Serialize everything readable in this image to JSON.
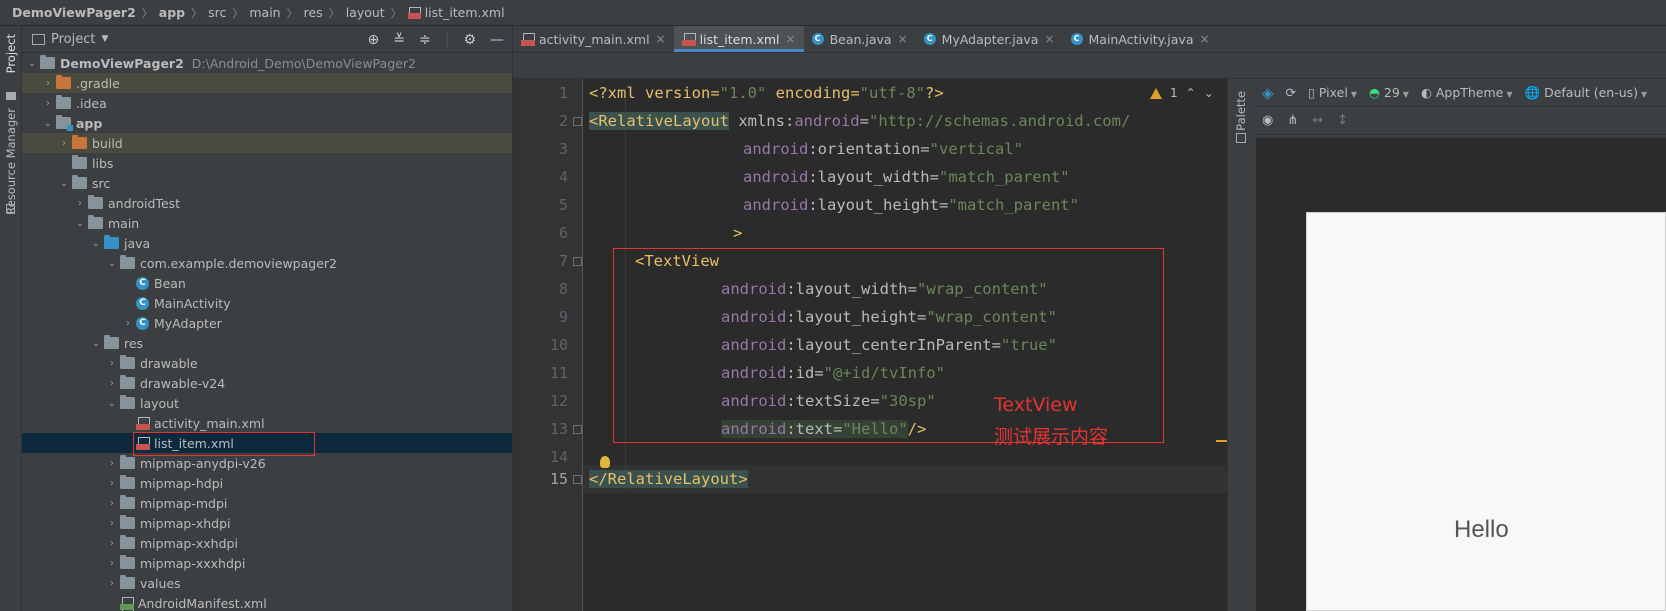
{
  "breadcrumb": [
    "DemoViewPager2",
    "app",
    "src",
    "main",
    "res",
    "layout",
    "list_item.xml"
  ],
  "left_stripe": {
    "project": "Project",
    "resource_manager": "Resource Manager"
  },
  "project_panel": {
    "title": "Project",
    "tree": [
      {
        "label": "DemoViewPager2",
        "extra": "D:\\Android_Demo\\DemoViewPager2"
      },
      {
        "label": ".gradle"
      },
      {
        "label": ".idea"
      },
      {
        "label": "app"
      },
      {
        "label": "build"
      },
      {
        "label": "libs"
      },
      {
        "label": "src"
      },
      {
        "label": "androidTest"
      },
      {
        "label": "main"
      },
      {
        "label": "java"
      },
      {
        "label": "com.example.demoviewpager2"
      },
      {
        "label": "Bean"
      },
      {
        "label": "MainActivity"
      },
      {
        "label": "MyAdapter"
      },
      {
        "label": "res"
      },
      {
        "label": "drawable"
      },
      {
        "label": "drawable-v24"
      },
      {
        "label": "layout"
      },
      {
        "label": "activity_main.xml"
      },
      {
        "label": "list_item.xml"
      },
      {
        "label": "mipmap-anydpi-v26"
      },
      {
        "label": "mipmap-hdpi"
      },
      {
        "label": "mipmap-mdpi"
      },
      {
        "label": "mipmap-xhdpi"
      },
      {
        "label": "mipmap-xxhdpi"
      },
      {
        "label": "mipmap-xxxhdpi"
      },
      {
        "label": "values"
      },
      {
        "label": "AndroidManifest.xml"
      }
    ]
  },
  "tabs": [
    "activity_main.xml",
    "list_item.xml",
    "Bean.java",
    "MyAdapter.java",
    "MainActivity.java"
  ],
  "editor": {
    "line_numbers": [
      "1",
      "2",
      "3",
      "4",
      "5",
      "6",
      "7",
      "8",
      "9",
      "10",
      "11",
      "12",
      "13",
      "14",
      "15"
    ],
    "warning_count": "1",
    "lines": {
      "l1": {
        "a": "<?xml version=",
        "b": "\"1.0\"",
        "c": " encoding=",
        "d": "\"utf-8\"",
        "e": "?>"
      },
      "l2": {
        "a": "<RelativeLayout",
        "b": " xmlns:",
        "c": "android",
        "d": "=",
        "e": "\"http://schemas.android.com/"
      },
      "l3": {
        "ns": "android",
        "attr": ":orientation=",
        "val": "\"vertical\""
      },
      "l4": {
        "ns": "android",
        "attr": ":layout_width=",
        "val": "\"match_parent\""
      },
      "l5": {
        "ns": "android",
        "attr": ":layout_height=",
        "val": "\"match_parent\""
      },
      "l6": {
        "a": ">"
      },
      "l7": {
        "a": "<TextView"
      },
      "l8": {
        "ns": "android",
        "attr": ":layout_width=",
        "val": "\"wrap_content\""
      },
      "l9": {
        "ns": "android",
        "attr": ":layout_height=",
        "val": "\"wrap_content\""
      },
      "l10": {
        "ns": "android",
        "attr": ":layout_centerInParent=",
        "val": "\"true\""
      },
      "l11": {
        "ns": "android",
        "attr": ":id=",
        "val": "\"@+id/tvInfo\""
      },
      "l12": {
        "ns": "android",
        "attr": ":textSize=",
        "val": "\"30sp\""
      },
      "l13": {
        "ns": "android",
        "attr": ":text=",
        "val": "\"Hello\"",
        "end": "/>"
      },
      "l15": {
        "a": "</RelativeLayout>"
      }
    }
  },
  "annotation": {
    "line1": "TextView",
    "line2": "测试展示内容"
  },
  "palette": "Palette",
  "design": {
    "device": "Pixel",
    "api": "29",
    "theme": "AppTheme",
    "locale": "Default (en-us)",
    "preview_text": "Hello"
  }
}
